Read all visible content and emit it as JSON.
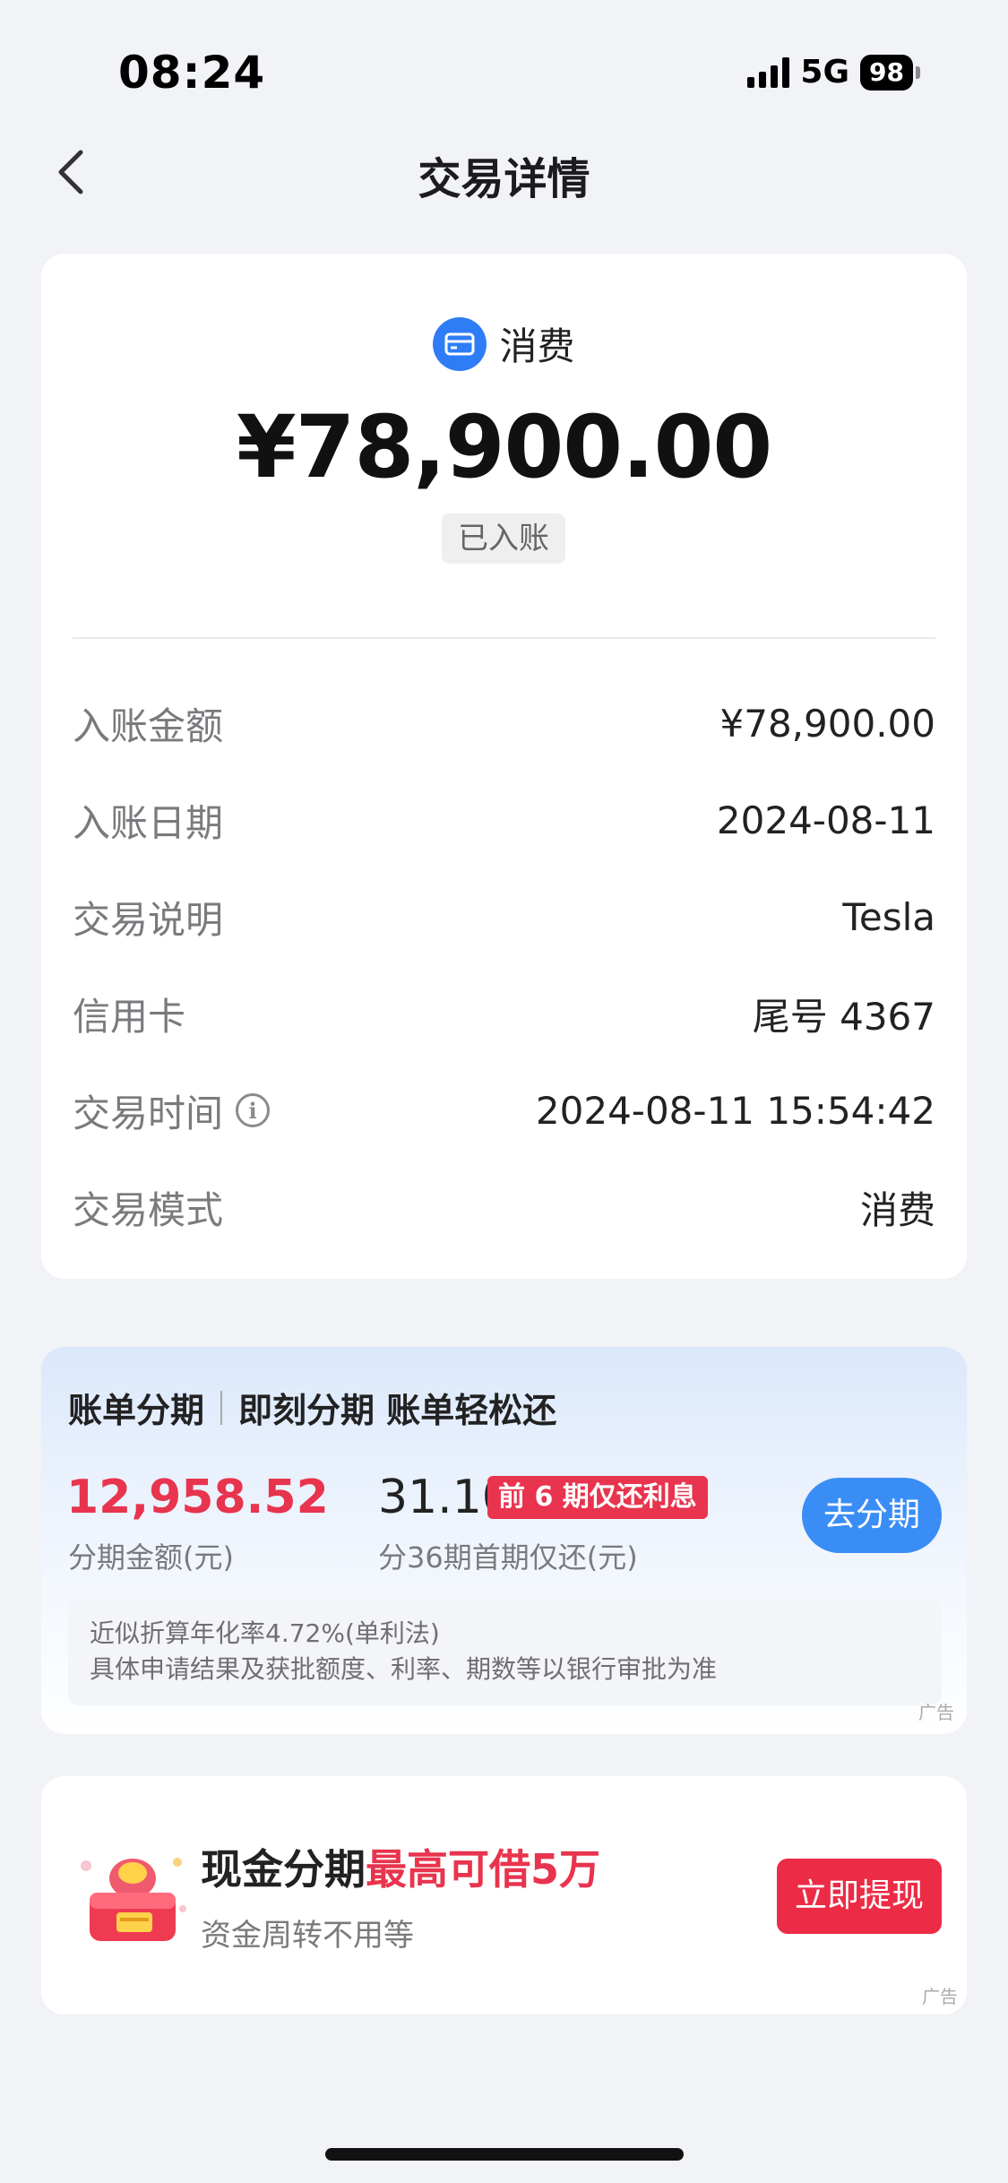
{
  "status_bar": {
    "time": "08:24",
    "network": "5G",
    "battery": "98"
  },
  "nav": {
    "title": "交易详情"
  },
  "detail": {
    "type_label": "消费",
    "amount": "¥78,900.00",
    "status": "已入账",
    "rows": [
      {
        "label": "入账金额",
        "value": "¥78,900.00"
      },
      {
        "label": "入账日期",
        "value": "2024-08-11"
      },
      {
        "label": "交易说明",
        "value": "Tesla"
      },
      {
        "label": "信用卡",
        "value": "尾号 4367"
      },
      {
        "label": "交易时间",
        "value": "2024-08-11 15:54:42"
      },
      {
        "label": "交易模式",
        "value": "消费"
      }
    ]
  },
  "installment": {
    "title_left": "账单分期",
    "title_right": "即刻分期 账单轻松还",
    "amount": "12,958.52",
    "amount_label": "分期金额(元)",
    "first_payment": "31.10",
    "badge": "前 6 期仅还利息",
    "first_payment_label": "分36期首期仅还(元)",
    "button": "去分期",
    "note_line1": "近似折算年化率4.72%(单利法)",
    "note_line2": "具体申请结果及获批额度、利率、期数等以银行审批为准",
    "ad": "广告"
  },
  "cash": {
    "title_prefix": "现金分期",
    "title_highlight": "最高可借5万",
    "subtitle": "资金周转不用等",
    "button": "立即提现",
    "ad": "广告"
  },
  "colors": {
    "accent_blue": "#2f7df6",
    "accent_red": "#e8344e"
  }
}
